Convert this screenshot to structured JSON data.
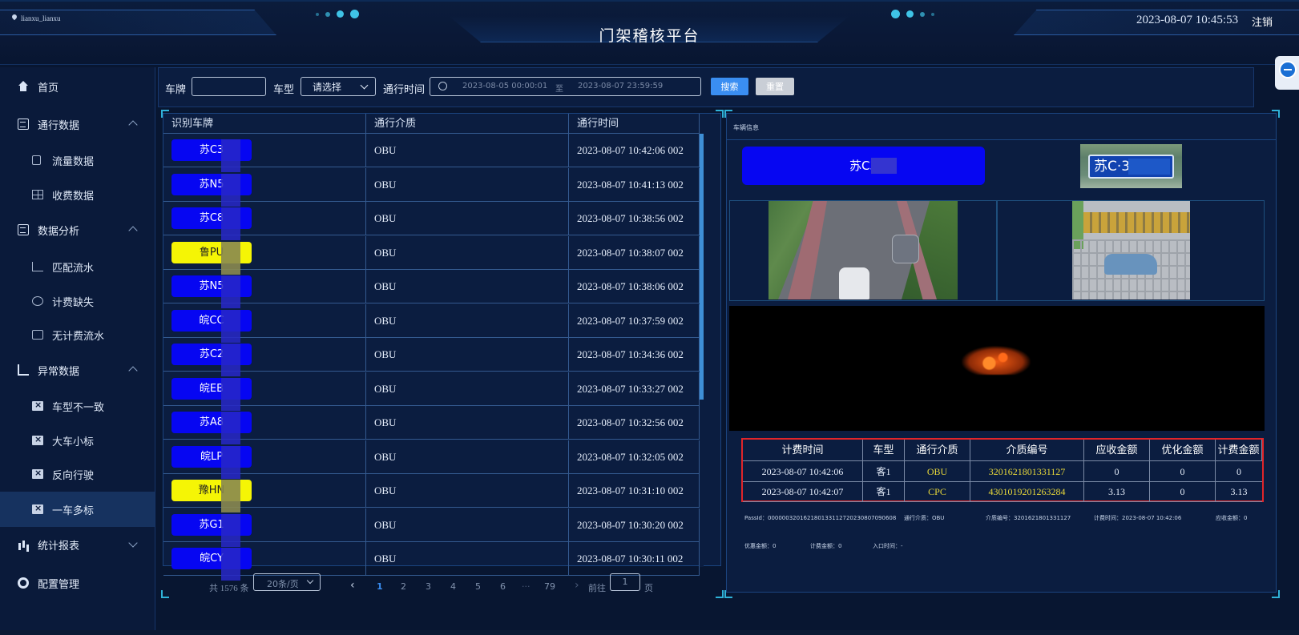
{
  "header": {
    "user": "lianxu_lianxu",
    "title": "门架稽核平台",
    "datetime": "2023-08-07 10:45:53",
    "logout_label": "注销"
  },
  "sidebar": {
    "items": [
      {
        "label": "首页",
        "icon": "home-icon"
      },
      {
        "label": "通行数据",
        "icon": "document-icon",
        "expanded": true
      },
      {
        "label": "流量数据",
        "icon": "camera-icon"
      },
      {
        "label": "收费数据",
        "icon": "grid-icon"
      },
      {
        "label": "数据分析",
        "icon": "clipboard-icon",
        "expanded": true
      },
      {
        "label": "匹配流水",
        "icon": "line-chart-icon"
      },
      {
        "label": "计费缺失",
        "icon": "coin-icon"
      },
      {
        "label": "无计费流水",
        "icon": "monitor-icon"
      },
      {
        "label": "异常数据",
        "icon": "trend-icon",
        "expanded": true
      },
      {
        "label": "车型不一致",
        "icon": "clipboard-x-icon"
      },
      {
        "label": "大车小标",
        "icon": "clipboard-x-icon"
      },
      {
        "label": "反向行驶",
        "icon": "clipboard-x-icon"
      },
      {
        "label": "一车多标",
        "icon": "clipboard-x-icon",
        "active": true
      },
      {
        "label": "统计报表",
        "icon": "bar-chart-icon",
        "expanded": false
      },
      {
        "label": "配置管理",
        "icon": "gear-icon"
      }
    ]
  },
  "search": {
    "plate_label": "车牌",
    "plate_value": "",
    "type_label": "车型",
    "type_placeholder": "请选择",
    "time_label": "通行时间",
    "start_time": "2023-08-05 00:00:01",
    "range_sep": "至",
    "end_time": "2023-08-07 23:59:59",
    "search_button": "搜索",
    "reset_button": "重置"
  },
  "table": {
    "columns": [
      "识别车牌",
      "通行介质",
      "通行时间"
    ],
    "rows": [
      {
        "plate": "苏C3",
        "color": "blue",
        "medium": "OBU",
        "time": "2023-08-07 10:42:06 002"
      },
      {
        "plate": "苏N5",
        "color": "blue",
        "medium": "OBU",
        "time": "2023-08-07 10:41:13 002"
      },
      {
        "plate": "苏C8",
        "color": "blue",
        "medium": "OBU",
        "time": "2023-08-07 10:38:56 002"
      },
      {
        "plate": "鲁PU",
        "color": "yellow",
        "medium": "OBU",
        "time": "2023-08-07 10:38:07 002"
      },
      {
        "plate": "苏N5",
        "color": "blue",
        "medium": "OBU",
        "time": "2023-08-07 10:38:06 002"
      },
      {
        "plate": "皖CC",
        "color": "blue",
        "medium": "OBU",
        "time": "2023-08-07 10:37:59 002"
      },
      {
        "plate": "苏C2",
        "color": "blue",
        "medium": "OBU",
        "time": "2023-08-07 10:34:36 002"
      },
      {
        "plate": "皖EB",
        "color": "blue",
        "medium": "OBU",
        "time": "2023-08-07 10:33:27 002"
      },
      {
        "plate": "苏A8",
        "color": "blue",
        "medium": "OBU",
        "time": "2023-08-07 10:32:56 002"
      },
      {
        "plate": "皖LP",
        "color": "blue",
        "medium": "OBU",
        "time": "2023-08-07 10:32:05 002"
      },
      {
        "plate": "豫HN",
        "color": "yellow",
        "medium": "OBU",
        "time": "2023-08-07 10:31:10 002"
      },
      {
        "plate": "苏G1",
        "color": "blue",
        "medium": "OBU",
        "time": "2023-08-07 10:30:20 002"
      },
      {
        "plate": "皖CY",
        "color": "blue",
        "medium": "OBU",
        "time": "2023-08-07 10:30:11 002"
      }
    ]
  },
  "pagination": {
    "total_text": "共 1576 条",
    "page_size": "20条/页",
    "prev": "‹",
    "pages": [
      "1",
      "2",
      "3",
      "4",
      "5",
      "6"
    ],
    "ellipsis": "···",
    "last_page": "79",
    "next": "›",
    "goto_label": "前往",
    "goto_value": "1",
    "page_unit": "页",
    "current_page": 1
  },
  "vehicle": {
    "panel_title": "车辆信息",
    "plate": "苏C3",
    "plate_img_text": "苏C·3"
  },
  "fee_table": {
    "columns": [
      "计费时间",
      "车型",
      "通行介质",
      "介质编号",
      "应收金额",
      "优化金额",
      "计费金额"
    ],
    "rows": [
      [
        "2023-08-07 10:42:06",
        "客1",
        "OBU",
        "3201621801331127",
        "0",
        "0",
        "0"
      ],
      [
        "2023-08-07 10:42:07",
        "客1",
        "CPC",
        "4301019201263284",
        "3.13",
        "0",
        "3.13"
      ]
    ]
  },
  "details": {
    "passid": "PassId：000000320162180133112720230807090608",
    "medium": "通行介质：OBU",
    "medium_no": "介质编号：3201621801331127",
    "fee_time": "计费时间：2023-08-07 10:42:06",
    "receivable": "应收金额：0",
    "discount": "优惠金额：0",
    "fee": "计费金额：0",
    "entry_time": "入口时间：-"
  },
  "colors": {
    "accent": "#3a8ef2",
    "plate_blue": "#0606f2",
    "plate_yellow": "#f5f505",
    "highlight_border": "#e0252a",
    "medium_text": "#e8d83a"
  }
}
